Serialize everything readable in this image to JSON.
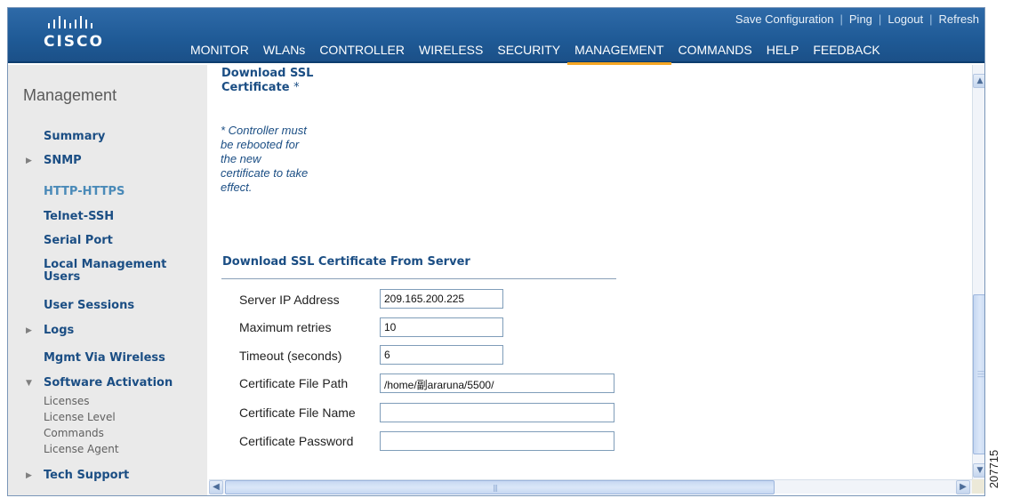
{
  "brand": {
    "logo_text": "CISCO"
  },
  "utility_links": [
    {
      "label": "Save Configuration"
    },
    {
      "label": "Ping"
    },
    {
      "label": "Logout"
    },
    {
      "label": "Refresh"
    }
  ],
  "nav": {
    "items": [
      "MONITOR",
      "WLANs",
      "CONTROLLER",
      "WIRELESS",
      "SECURITY",
      "MANAGEMENT",
      "COMMANDS",
      "HELP",
      "FEEDBACK"
    ],
    "active": "MANAGEMENT"
  },
  "sidebar": {
    "title": "Management",
    "items": [
      {
        "label": "Summary"
      },
      {
        "label": "SNMP"
      },
      {
        "label": "HTTP-HTTPS"
      },
      {
        "label": "Telnet-SSH"
      },
      {
        "label": "Serial Port"
      },
      {
        "label": "Local Management Users"
      },
      {
        "label": "User Sessions"
      },
      {
        "label": "Logs"
      },
      {
        "label": "Mgmt Via Wireless"
      },
      {
        "label": "Software Activation"
      },
      {
        "label": "Tech Support"
      }
    ],
    "sub_items": [
      "Licenses",
      "License Level",
      "Commands",
      "License Agent"
    ]
  },
  "main": {
    "download_title": "Download SSL Certificate",
    "download_star": "*",
    "note": "* Controller must be rebooted for the new certificate to take effect.",
    "section_title": "Download SSL Certificate From Server",
    "fields": [
      {
        "label": "Server IP Address",
        "value": "209.165.200.225"
      },
      {
        "label": "Maximum retries",
        "value": "10"
      },
      {
        "label": "Timeout (seconds)",
        "value": "6"
      },
      {
        "label": "Certificate File Path",
        "value": "/home/副araruna/5500/"
      },
      {
        "label": "Certificate File Name",
        "value": ""
      },
      {
        "label": "Certificate Password",
        "value": ""
      }
    ]
  },
  "figure_id": "207715",
  "colors": {
    "header_blue": "#1f5a96",
    "active_tab_underline": "#f5a623",
    "link_blue": "#1b4e84"
  }
}
